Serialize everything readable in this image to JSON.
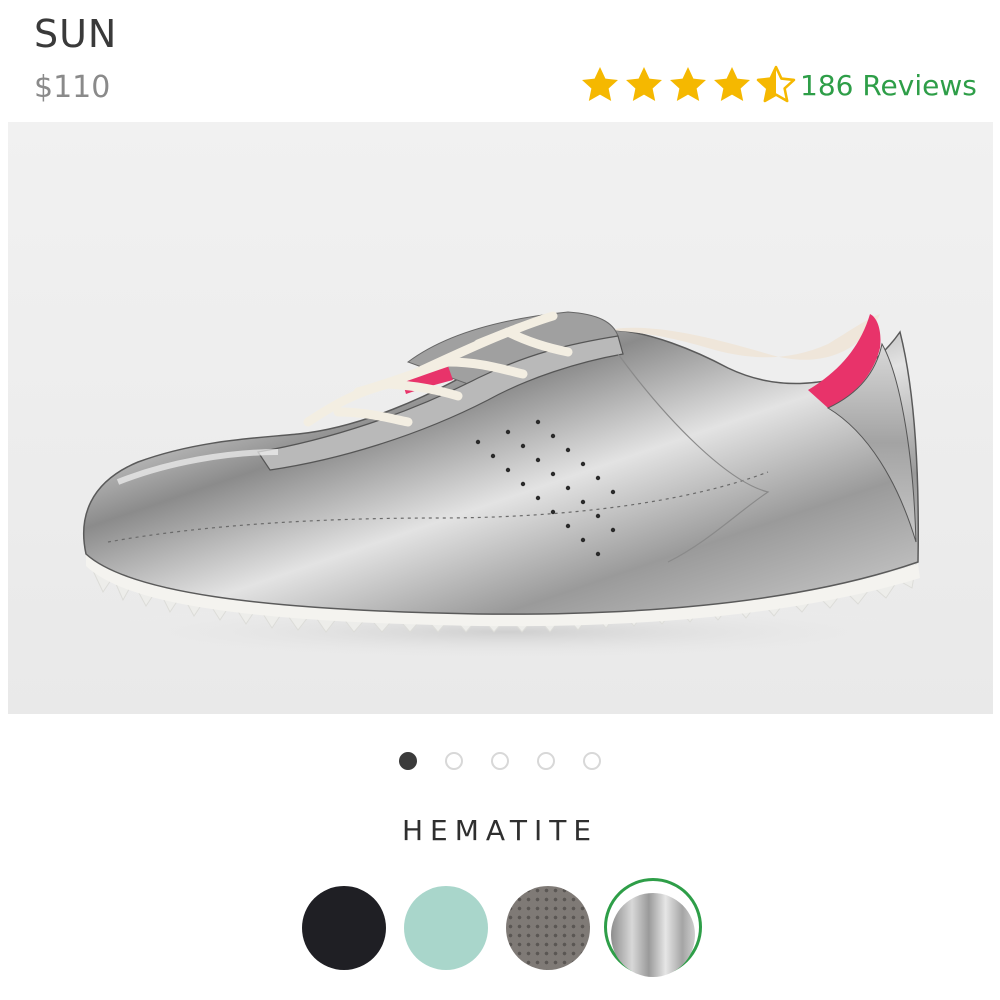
{
  "product": {
    "name": "SUN",
    "price": "$110",
    "rating": 4.5,
    "reviews_label": "186 Reviews",
    "star_color": "#f5b800",
    "review_link_color": "#2e9e48"
  },
  "gallery": {
    "image_alt": "silver-leather-sneaker-photo",
    "total_images": 5,
    "active_index": 0
  },
  "color_selector": {
    "selected_name": "HEMATITE",
    "selected_index": 3,
    "swatches": [
      {
        "name": "black-swatch",
        "color": "#1f1f24"
      },
      {
        "name": "mint-swatch",
        "color": "#a9d6cb"
      },
      {
        "name": "taupe-perforated-swatch",
        "color": "#7f7a76"
      },
      {
        "name": "silver-swatch",
        "color": "#b9b9b9"
      }
    ],
    "selected_ring_color": "#2e9e48"
  }
}
